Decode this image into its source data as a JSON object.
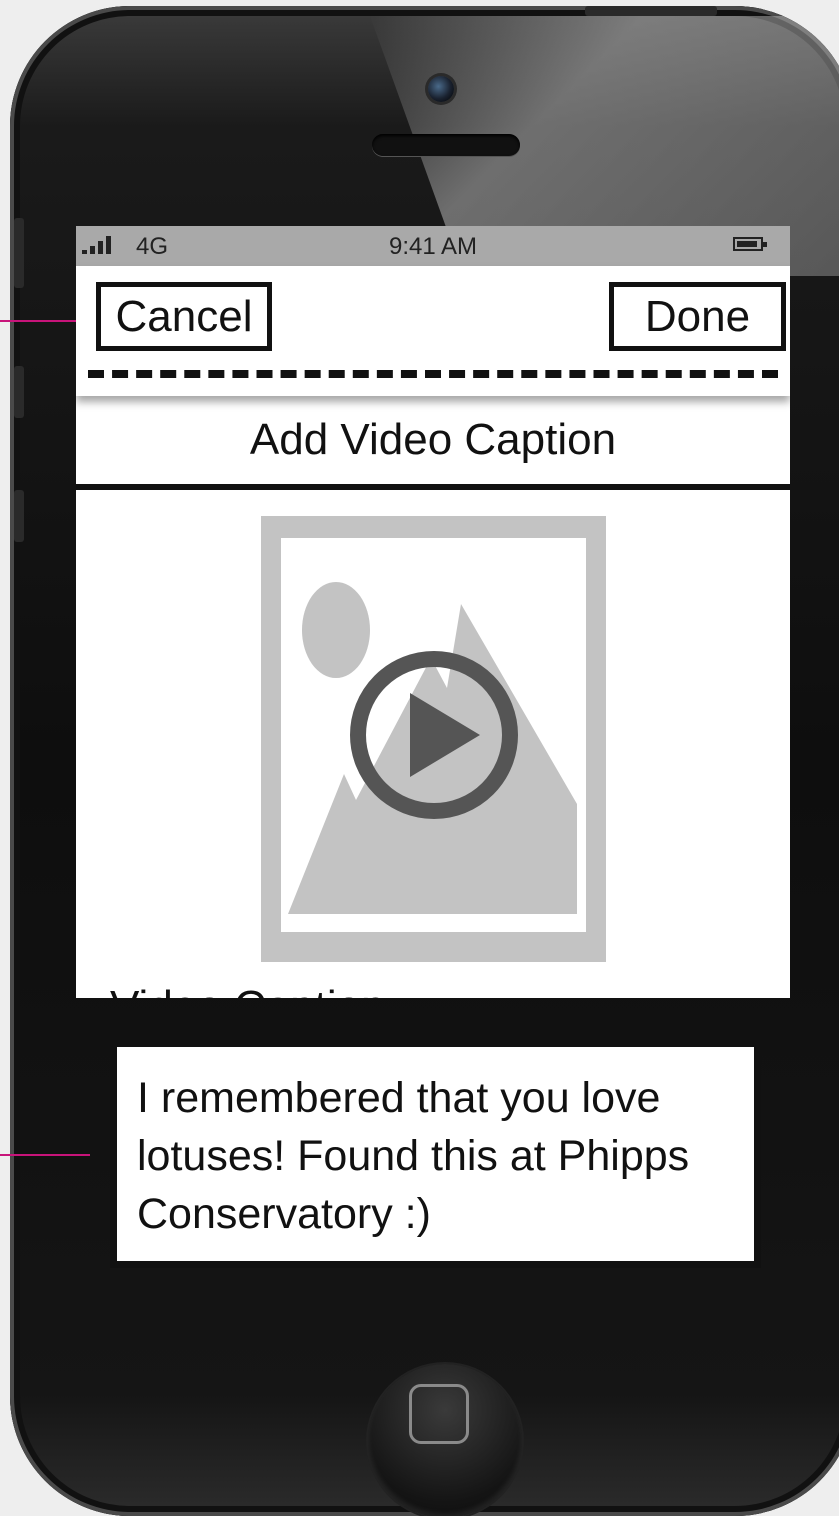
{
  "status_bar": {
    "network": "4G",
    "time": "9:41 AM"
  },
  "nav_bar": {
    "cancel_label": "Cancel",
    "done_label": "Done"
  },
  "page_title": "Add Video Caption",
  "video": {
    "thumbnail_icon": "image-placeholder-icon",
    "play_icon": "play-icon"
  },
  "caption": {
    "label": "Video Caption",
    "value": "I remembered that you love lotuses! Found this at Phipps Conservatory :)"
  },
  "colors": {
    "annotation": "#c8147a",
    "placeholder": "#c3c3c3",
    "play": "#555555",
    "status_bar": "#a9a9a9"
  }
}
